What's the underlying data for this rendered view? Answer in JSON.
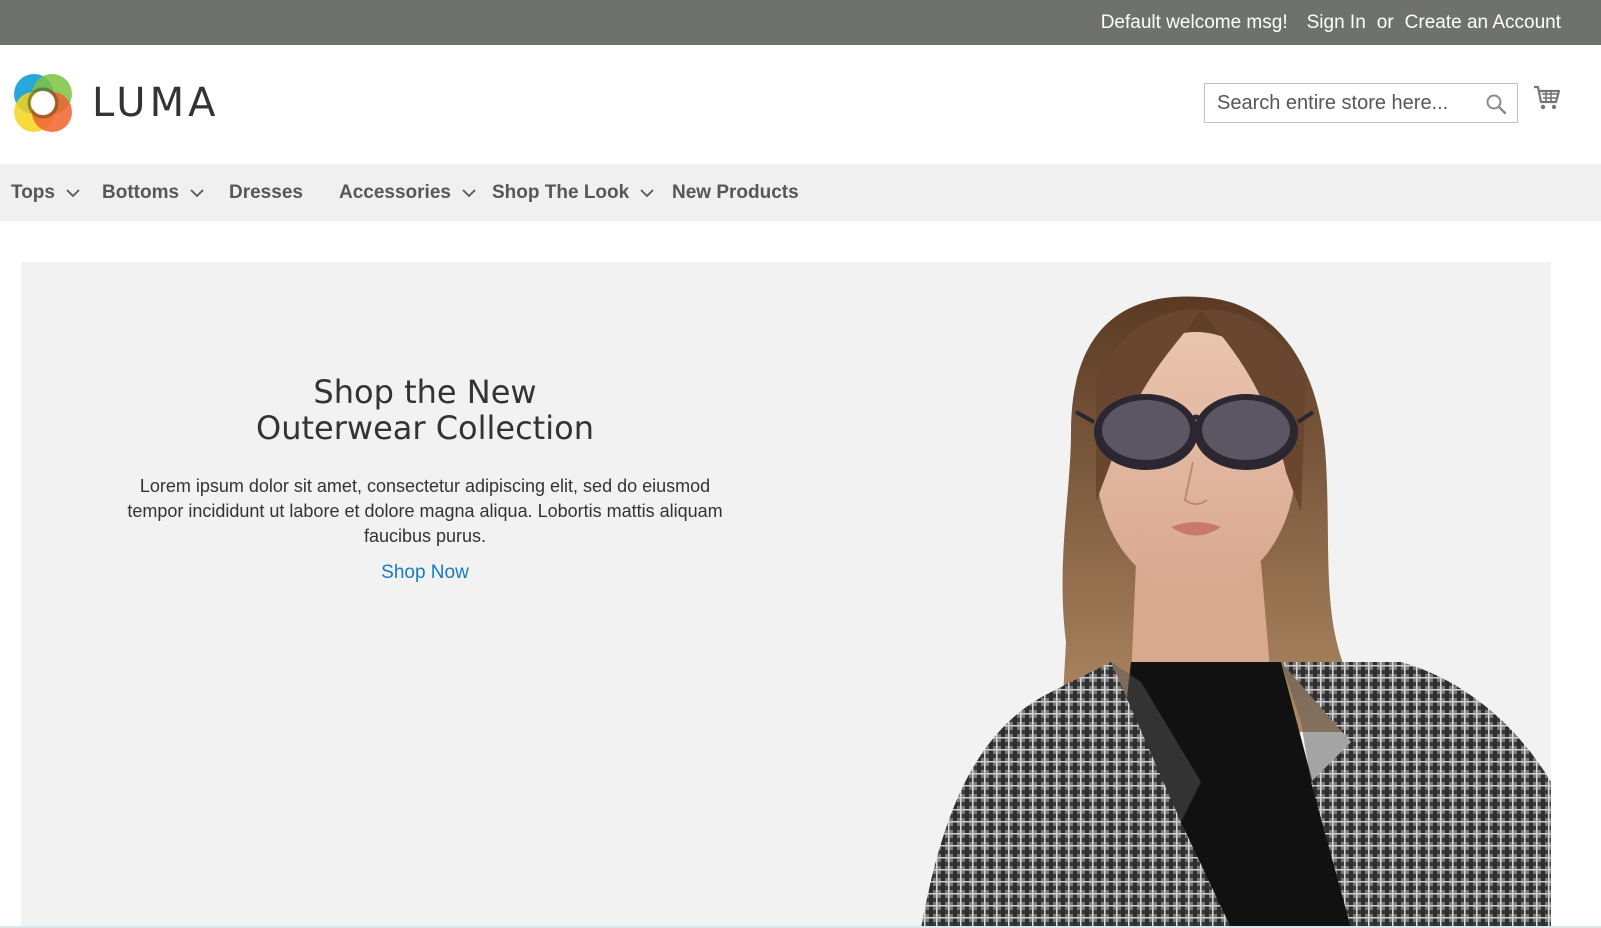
{
  "top_panel": {
    "welcome": "Default welcome msg!",
    "sign_in": "Sign In",
    "or": "or",
    "create_account": "Create an Account"
  },
  "header": {
    "logo_text": "LUMA",
    "search_placeholder": "Search entire store here...",
    "cart_icon": "shopping-cart-icon",
    "search_icon": "magnifier-icon"
  },
  "nav": {
    "items": [
      {
        "label": "Tops",
        "has_submenu": true
      },
      {
        "label": "Bottoms",
        "has_submenu": true
      },
      {
        "label": "Dresses",
        "has_submenu": false
      },
      {
        "label": "Accessories",
        "has_submenu": true
      },
      {
        "label": "Shop The Look",
        "has_submenu": true
      },
      {
        "label": "New Products",
        "has_submenu": false
      }
    ]
  },
  "hero": {
    "title_line1": "Shop the New",
    "title_line2": "Outerwear Collection",
    "description": "Lorem ipsum dolor sit amet, consectetur adipiscing elit, sed do eiusmod tempor incididunt ut labore et dolore magna aliqua. Lobortis mattis aliquam faucibus purus.",
    "cta": "Shop Now"
  },
  "colors": {
    "top_panel_bg": "#6e716e",
    "nav_bg": "#f0f0f0",
    "hero_bg": "#f2f2f2",
    "link": "#1979c3"
  }
}
